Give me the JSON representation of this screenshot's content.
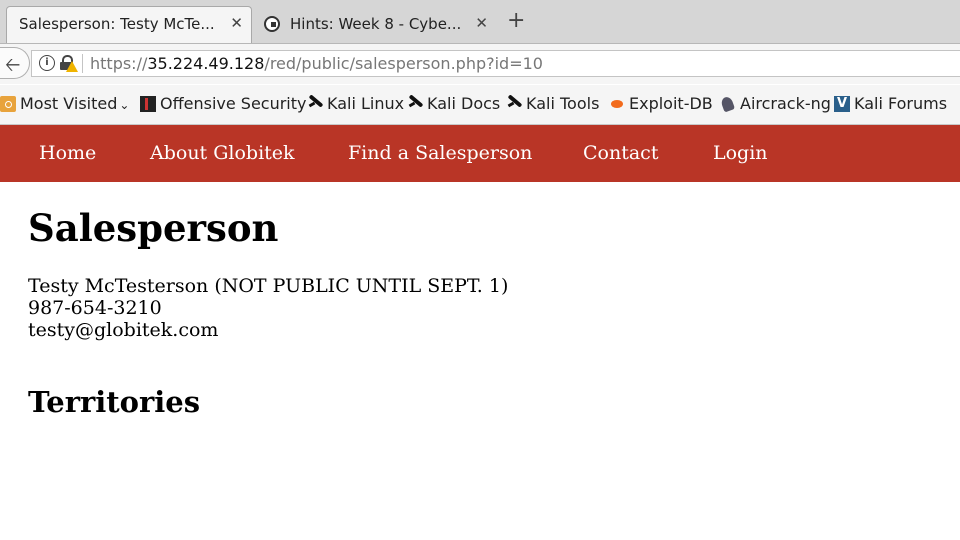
{
  "browser": {
    "tabs": [
      {
        "title": "Salesperson: Testy McTe...",
        "close": "✕",
        "active": true
      },
      {
        "title": "Hints: Week 8 - Cybe...",
        "close": "✕",
        "active": false
      }
    ],
    "new_tab": "+",
    "url": {
      "scheme": "https://",
      "host": "35.224.49.128",
      "path": "/red/public/salesperson.php?id=10"
    },
    "bookmarks": [
      {
        "label": "Most Visited",
        "icon": "folder-icon",
        "dropdown": "⌄"
      },
      {
        "label": "Offensive Security",
        "icon": "offensive-security-icon"
      },
      {
        "label": "Kali Linux",
        "icon": "kali-dragon-icon"
      },
      {
        "label": "Kali Docs",
        "icon": "kali-dragon-icon"
      },
      {
        "label": "Kali Tools",
        "icon": "kali-dragon-icon"
      },
      {
        "label": "Exploit-DB",
        "icon": "exploit-db-icon"
      },
      {
        "label": "Aircrack-ng",
        "icon": "aircrack-icon"
      },
      {
        "label": "Kali Forums",
        "icon": "kali-forums-icon"
      }
    ]
  },
  "site": {
    "accent_color": "#b93526",
    "nav": [
      "Home",
      "About Globitek",
      "Find a Salesperson",
      "Contact",
      "Login"
    ],
    "page_title": "Salesperson",
    "salesperson": {
      "name": "Testy McTesterson (NOT PUBLIC UNTIL SEPT. 1)",
      "phone": "987-654-3210",
      "email": "testy@globitek.com"
    },
    "territories_heading": "Territories"
  }
}
